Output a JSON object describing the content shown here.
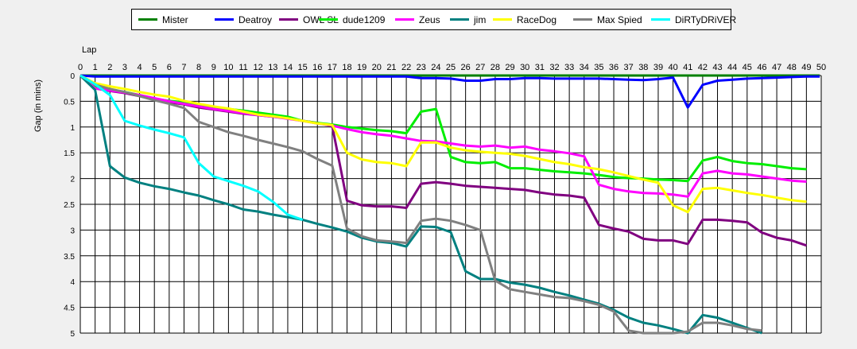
{
  "chart_data": {
    "type": "line",
    "title": "",
    "xlabel": "Lap",
    "ylabel": "Gap (in mins)",
    "xlim": [
      0,
      50
    ],
    "ylim": [
      0,
      5
    ],
    "y_inverted": true,
    "x_ticks": [
      0,
      1,
      2,
      3,
      4,
      5,
      6,
      7,
      8,
      9,
      10,
      11,
      12,
      13,
      14,
      15,
      16,
      17,
      18,
      19,
      20,
      21,
      22,
      23,
      24,
      25,
      26,
      27,
      28,
      29,
      30,
      31,
      32,
      33,
      34,
      35,
      36,
      37,
      38,
      39,
      40,
      41,
      42,
      43,
      44,
      45,
      46,
      47,
      48,
      49,
      50
    ],
    "y_ticks": [
      "0",
      "0.5",
      "1",
      "1.5",
      "2",
      "2.5",
      "3",
      "3.5",
      "4",
      "4.5",
      "5"
    ],
    "y_tick_values": [
      0,
      0.5,
      1,
      1.5,
      2,
      2.5,
      3,
      3.5,
      4,
      4.5,
      5
    ],
    "grid": true,
    "legend_position": "top",
    "series": [
      {
        "name": "Mister",
        "color": "#008000",
        "x": [
          0,
          49.9
        ],
        "y": [
          0,
          0
        ]
      },
      {
        "name": "Deatroy",
        "color": "#0000ff",
        "x": [
          0,
          1,
          2,
          3,
          4,
          5,
          6,
          7,
          8,
          9,
          10,
          11,
          12,
          13,
          14,
          15,
          16,
          17,
          18,
          19,
          20,
          21,
          22,
          23,
          24,
          25,
          26,
          27,
          28,
          29,
          30,
          31,
          32,
          33,
          34,
          35,
          36,
          37,
          38,
          39,
          40,
          41,
          42,
          43,
          44,
          45,
          46,
          47,
          48,
          49,
          49.9
        ],
        "y": [
          0,
          0.02,
          0.02,
          0.02,
          0.02,
          0.02,
          0.02,
          0.02,
          0.02,
          0.02,
          0.02,
          0.02,
          0.02,
          0.02,
          0.02,
          0.02,
          0.02,
          0.02,
          0.02,
          0.02,
          0.02,
          0.02,
          0.02,
          0.05,
          0.05,
          0.06,
          0.1,
          0.1,
          0.07,
          0.07,
          0.05,
          0.05,
          0.06,
          0.06,
          0.06,
          0.06,
          0.07,
          0.08,
          0.09,
          0.07,
          0.04,
          0.62,
          0.18,
          0.1,
          0.08,
          0.06,
          0.05,
          0.04,
          0.03,
          0.02,
          0.02
        ]
      },
      {
        "name": "OWL SL",
        "color": "#800080",
        "x": [
          0,
          1,
          2,
          3,
          4,
          5,
          6,
          7,
          8,
          9,
          10,
          11,
          12,
          13,
          14,
          15,
          16,
          17,
          18,
          19,
          20,
          21,
          22,
          23,
          24,
          25,
          26,
          27,
          28,
          29,
          30,
          31,
          32,
          33,
          34,
          35,
          36,
          37,
          38,
          39,
          40,
          41,
          42,
          43,
          44,
          45,
          46,
          47,
          48,
          49
        ],
        "y": [
          0,
          0.25,
          0.3,
          0.34,
          0.4,
          0.46,
          0.52,
          0.56,
          0.62,
          0.66,
          0.7,
          0.74,
          0.77,
          0.8,
          0.83,
          0.88,
          0.92,
          0.98,
          2.43,
          2.52,
          2.54,
          2.54,
          2.57,
          2.1,
          2.07,
          2.1,
          2.14,
          2.16,
          2.18,
          2.2,
          2.22,
          2.27,
          2.31,
          2.33,
          2.37,
          2.9,
          2.97,
          3.03,
          3.17,
          3.2,
          3.2,
          3.27,
          2.8,
          2.8,
          2.82,
          2.85,
          3.05,
          3.15,
          3.2,
          3.3
        ]
      },
      {
        "name": "dude1209",
        "color": "#00ee00",
        "x": [
          0,
          1,
          2,
          3,
          4,
          5,
          6,
          7,
          8,
          9,
          10,
          11,
          12,
          13,
          14,
          15,
          16,
          17,
          18,
          19,
          20,
          21,
          22,
          23,
          24,
          25,
          26,
          27,
          28,
          29,
          30,
          31,
          32,
          33,
          34,
          35,
          36,
          37,
          38,
          39,
          40,
          41,
          42,
          43,
          44,
          45,
          46,
          47,
          48,
          49
        ],
        "y": [
          0,
          0.2,
          0.27,
          0.32,
          0.38,
          0.45,
          0.49,
          0.52,
          0.57,
          0.61,
          0.65,
          0.68,
          0.72,
          0.76,
          0.8,
          0.88,
          0.92,
          0.95,
          1.0,
          1.03,
          1.06,
          1.08,
          1.12,
          0.7,
          0.65,
          1.58,
          1.68,
          1.7,
          1.68,
          1.8,
          1.8,
          1.83,
          1.86,
          1.88,
          1.9,
          1.93,
          1.97,
          1.99,
          2.0,
          2.02,
          2.03,
          2.05,
          1.65,
          1.58,
          1.66,
          1.7,
          1.72,
          1.76,
          1.8,
          1.82
        ]
      },
      {
        "name": "Zeus",
        "color": "#ff00ff",
        "x": [
          0,
          1,
          2,
          3,
          4,
          5,
          6,
          7,
          8,
          9,
          10,
          11,
          12,
          13,
          14,
          15,
          16,
          17,
          18,
          19,
          20,
          21,
          22,
          23,
          24,
          25,
          26,
          27,
          28,
          29,
          30,
          31,
          32,
          33,
          34,
          35,
          36,
          37,
          38,
          39,
          40,
          41,
          42,
          43,
          44,
          45,
          46,
          47,
          48,
          49
        ],
        "y": [
          0,
          0.25,
          0.29,
          0.33,
          0.38,
          0.44,
          0.5,
          0.55,
          0.6,
          0.65,
          0.69,
          0.73,
          0.77,
          0.8,
          0.84,
          0.88,
          0.93,
          0.97,
          1.04,
          1.1,
          1.14,
          1.17,
          1.22,
          1.27,
          1.28,
          1.32,
          1.36,
          1.38,
          1.36,
          1.4,
          1.38,
          1.44,
          1.47,
          1.51,
          1.57,
          2.12,
          2.2,
          2.25,
          2.28,
          2.29,
          2.31,
          2.35,
          1.9,
          1.85,
          1.9,
          1.92,
          1.96,
          2.0,
          2.04,
          2.06
        ]
      },
      {
        "name": "jim",
        "color": "#008080",
        "x": [
          0,
          1,
          2,
          3,
          4,
          5,
          6,
          7,
          8,
          9,
          10,
          11,
          12,
          13,
          14,
          15,
          16,
          17,
          18,
          19,
          20,
          21,
          22,
          23,
          24,
          25,
          26,
          27,
          28,
          29,
          30,
          31,
          32,
          33,
          34,
          35,
          36,
          37,
          38,
          39,
          40,
          41,
          42,
          43,
          44,
          45,
          46
        ],
        "y": [
          0,
          0.28,
          1.76,
          1.98,
          2.08,
          2.15,
          2.2,
          2.27,
          2.33,
          2.42,
          2.5,
          2.6,
          2.64,
          2.7,
          2.75,
          2.8,
          2.88,
          2.95,
          3.03,
          3.15,
          3.22,
          3.25,
          3.32,
          2.93,
          2.94,
          3.04,
          3.8,
          3.95,
          3.95,
          4.02,
          4.06,
          4.12,
          4.2,
          4.27,
          4.35,
          4.43,
          4.55,
          4.7,
          4.8,
          4.85,
          4.92,
          5.0,
          4.65,
          4.7,
          4.8,
          4.9,
          5.0
        ]
      },
      {
        "name": "RaceDog",
        "color": "#ffff00",
        "x": [
          0,
          1,
          2,
          3,
          4,
          5,
          6,
          7,
          8,
          9,
          10,
          11,
          12,
          13,
          14,
          15,
          16,
          17,
          18,
          19,
          20,
          21,
          22,
          23,
          24,
          25,
          26,
          27,
          28,
          29,
          30,
          31,
          32,
          33,
          34,
          35,
          36,
          37,
          38,
          39,
          40,
          41,
          42,
          43,
          44,
          45,
          46,
          47,
          48,
          49
        ],
        "y": [
          0,
          0.15,
          0.21,
          0.26,
          0.32,
          0.37,
          0.41,
          0.49,
          0.55,
          0.6,
          0.64,
          0.7,
          0.76,
          0.79,
          0.83,
          0.88,
          0.93,
          0.96,
          1.5,
          1.63,
          1.68,
          1.7,
          1.76,
          1.3,
          1.3,
          1.4,
          1.45,
          1.48,
          1.5,
          1.52,
          1.56,
          1.62,
          1.68,
          1.72,
          1.78,
          1.82,
          1.88,
          1.95,
          2.02,
          2.08,
          2.52,
          2.65,
          2.2,
          2.18,
          2.23,
          2.28,
          2.32,
          2.37,
          2.42,
          2.45
        ]
      },
      {
        "name": "Max Spied",
        "color": "#808080",
        "x": [
          0,
          1,
          2,
          3,
          4,
          5,
          6,
          7,
          8,
          9,
          10,
          11,
          12,
          13,
          14,
          15,
          16,
          17,
          18,
          19,
          20,
          21,
          22,
          23,
          24,
          25,
          26,
          27,
          28,
          29,
          30,
          31,
          32,
          33,
          34,
          35,
          36,
          37,
          38,
          39,
          40,
          41,
          42,
          43,
          44,
          45,
          46
        ],
        "y": [
          0,
          0.18,
          0.26,
          0.32,
          0.4,
          0.48,
          0.55,
          0.63,
          0.9,
          1.0,
          1.1,
          1.17,
          1.25,
          1.32,
          1.39,
          1.47,
          1.62,
          1.75,
          2.97,
          3.12,
          3.2,
          3.22,
          3.25,
          2.82,
          2.78,
          2.82,
          2.9,
          3.0,
          3.98,
          4.15,
          4.2,
          4.25,
          4.3,
          4.32,
          4.38,
          4.45,
          4.58,
          4.95,
          5.0,
          5.0,
          5.0,
          4.97,
          4.8,
          4.8,
          4.85,
          4.92,
          4.95
        ]
      },
      {
        "name": "DiRTyDRiVER",
        "color": "#00ffff",
        "x": [
          0,
          1,
          2,
          3,
          4,
          5,
          6,
          7,
          8,
          9,
          10,
          11,
          12,
          13,
          14,
          15
        ],
        "y": [
          0,
          0.17,
          0.38,
          0.88,
          0.97,
          1.05,
          1.12,
          1.2,
          1.7,
          1.96,
          2.05,
          2.14,
          2.25,
          2.45,
          2.7,
          2.8
        ]
      }
    ]
  }
}
